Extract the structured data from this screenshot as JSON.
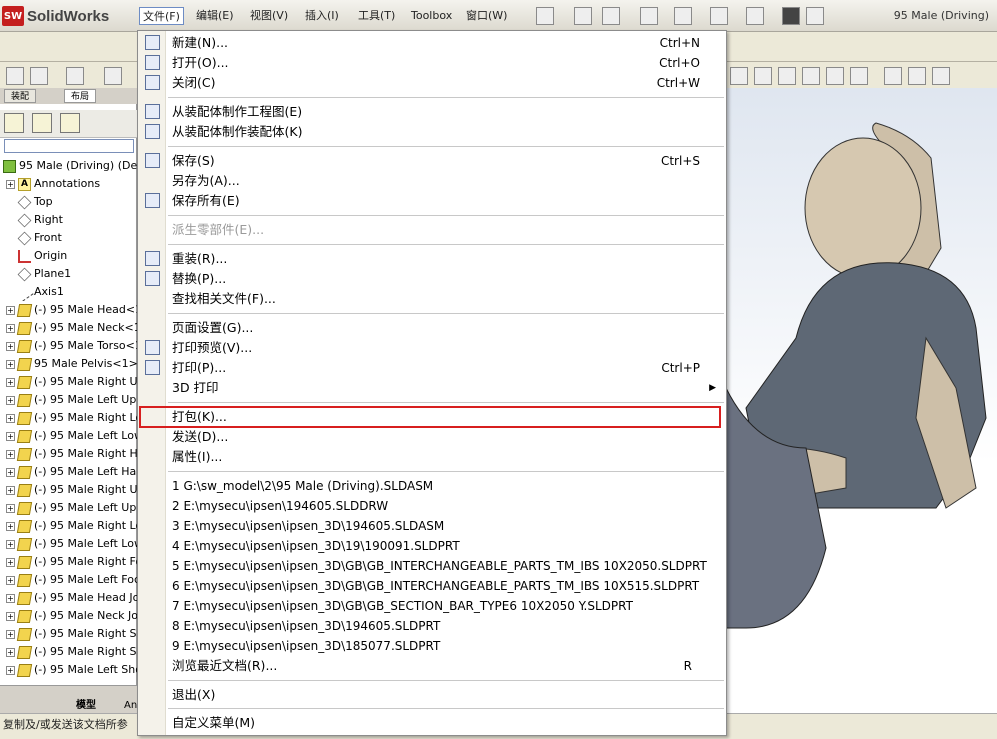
{
  "app": {
    "logo_badge": "SW",
    "logo_text": "SolidWorks",
    "document_title": "95 Male (Driving)"
  },
  "menubar": {
    "items": [
      "文件(F)",
      "编辑(E)",
      "视图(V)",
      "插入(I)",
      "工具(T)",
      "Toolbox",
      "窗口(W)"
    ]
  },
  "panel": {
    "tabs": [
      "装配",
      "布局"
    ],
    "root": "95 Male (Driving)  (Defa",
    "tree": [
      {
        "label": "Annotations",
        "icon": "annotations"
      },
      {
        "label": "Top",
        "icon": "plane"
      },
      {
        "label": "Right",
        "icon": "plane"
      },
      {
        "label": "Front",
        "icon": "plane"
      },
      {
        "label": "Origin",
        "icon": "origin"
      },
      {
        "label": "Plane1",
        "icon": "plane"
      },
      {
        "label": "Axis1",
        "icon": "axis"
      },
      {
        "label": "(-) 95 Male Head<1",
        "icon": "component"
      },
      {
        "label": "(-) 95 Male Neck<1",
        "icon": "component"
      },
      {
        "label": "(-) 95 Male Torso<1",
        "icon": "component"
      },
      {
        "label": "95 Male Pelvis<1>",
        "icon": "component"
      },
      {
        "label": "(-) 95 Male Right Up",
        "icon": "component"
      },
      {
        "label": "(-) 95 Male Left Upp",
        "icon": "component"
      },
      {
        "label": "(-) 95 Male Right Lo",
        "icon": "component"
      },
      {
        "label": "(-) 95 Male Left Low",
        "icon": "component"
      },
      {
        "label": "(-) 95 Male Right Ha",
        "icon": "component"
      },
      {
        "label": "(-) 95 Male Left Har",
        "icon": "component"
      },
      {
        "label": "(-) 95 Male Right Up",
        "icon": "component"
      },
      {
        "label": "(-) 95 Male Left Upp",
        "icon": "component"
      },
      {
        "label": "(-) 95 Male Right Lo",
        "icon": "component"
      },
      {
        "label": "(-) 95 Male Left Low",
        "icon": "component"
      },
      {
        "label": "(-) 95 Male Right Fo",
        "icon": "component"
      },
      {
        "label": "(-) 95 Male Left Foc",
        "icon": "component"
      },
      {
        "label": "(-) 95 Male Head Jo",
        "icon": "component"
      },
      {
        "label": "(-) 95 Male Neck Joi",
        "icon": "component"
      },
      {
        "label": "(-) 95 Male Right Sh",
        "icon": "component"
      },
      {
        "label": "(-) 95 Male Right Sh",
        "icon": "component"
      },
      {
        "label": "(-) 95 Male Left Sho",
        "icon": "component"
      }
    ],
    "bottom_tabs": [
      "模型",
      "An"
    ]
  },
  "file_menu": {
    "items": [
      {
        "label": "新建(N)...",
        "shortcut": "Ctrl+N",
        "icon": "new-doc-icon",
        "y": 0
      },
      {
        "label": "打开(O)...",
        "shortcut": "Ctrl+O",
        "icon": "open-folder-icon"
      },
      {
        "label": "关闭(C)",
        "shortcut": "Ctrl+W",
        "icon": "close-folder-icon"
      },
      {
        "label": "从装配体制作工程图(E)",
        "shortcut": "",
        "icon": "make-drawing-icon"
      },
      {
        "label": "从装配体制作装配体(K)",
        "shortcut": "",
        "icon": "make-assembly-icon"
      },
      {
        "label": "保存(S)",
        "shortcut": "Ctrl+S",
        "icon": "save-icon"
      },
      {
        "label": "另存为(A)...",
        "shortcut": "",
        "icon": ""
      },
      {
        "label": "保存所有(E)",
        "shortcut": "",
        "icon": "save-all-icon"
      },
      {
        "label": "派生零部件(E)...",
        "shortcut": "",
        "icon": "",
        "disabled": true
      },
      {
        "label": "重装(R)...",
        "shortcut": "",
        "icon": "reload-icon"
      },
      {
        "label": "替换(P)...",
        "shortcut": "",
        "icon": "replace-icon"
      },
      {
        "label": "查找相关文件(F)...",
        "shortcut": "",
        "icon": ""
      },
      {
        "label": "页面设置(G)...",
        "shortcut": "",
        "icon": ""
      },
      {
        "label": "打印预览(V)...",
        "shortcut": "",
        "icon": "print-preview-icon"
      },
      {
        "label": "打印(P)...",
        "shortcut": "Ctrl+P",
        "icon": "print-icon"
      },
      {
        "label": "3D 打印",
        "shortcut": "",
        "icon": "",
        "submenu": true
      },
      {
        "label": "打包(K)...",
        "shortcut": "",
        "icon": "",
        "highlighted": true
      },
      {
        "label": "发送(D)...",
        "shortcut": "",
        "icon": ""
      },
      {
        "label": "属性(I)...",
        "shortcut": "",
        "icon": ""
      }
    ],
    "recent_files": [
      "1 G:\\sw_model\\2\\95 Male (Driving).SLDASM",
      "2 E:\\mysecu\\ipsen\\194605.SLDDRW",
      "3 E:\\mysecu\\ipsen\\ipsen_3D\\194605.SLDASM",
      "4 E:\\mysecu\\ipsen\\ipsen_3D\\19\\190091.SLDPRT",
      "5 E:\\mysecu\\ipsen\\ipsen_3D\\GB\\GB_INTERCHANGEABLE_PARTS_TM_IBS 10X2050.SLDPRT",
      "6 E:\\mysecu\\ipsen\\ipsen_3D\\GB\\GB_INTERCHANGEABLE_PARTS_TM_IBS 10X515.SLDPRT",
      "7 E:\\mysecu\\ipsen\\ipsen_3D\\GB\\GB_SECTION_BAR_TYPE6 10X2050 Y.SLDPRT",
      "8 E:\\mysecu\\ipsen\\ipsen_3D\\194605.SLDPRT",
      "9 E:\\mysecu\\ipsen\\ipsen_3D\\185077.SLDPRT"
    ],
    "browse_recent": "浏览最近文档(R)...",
    "browse_recent_shortcut": "R",
    "exit": "退出(X)",
    "customize": "自定义菜单(M)"
  },
  "status": {
    "text": "复制及/或发送该文档所参"
  }
}
